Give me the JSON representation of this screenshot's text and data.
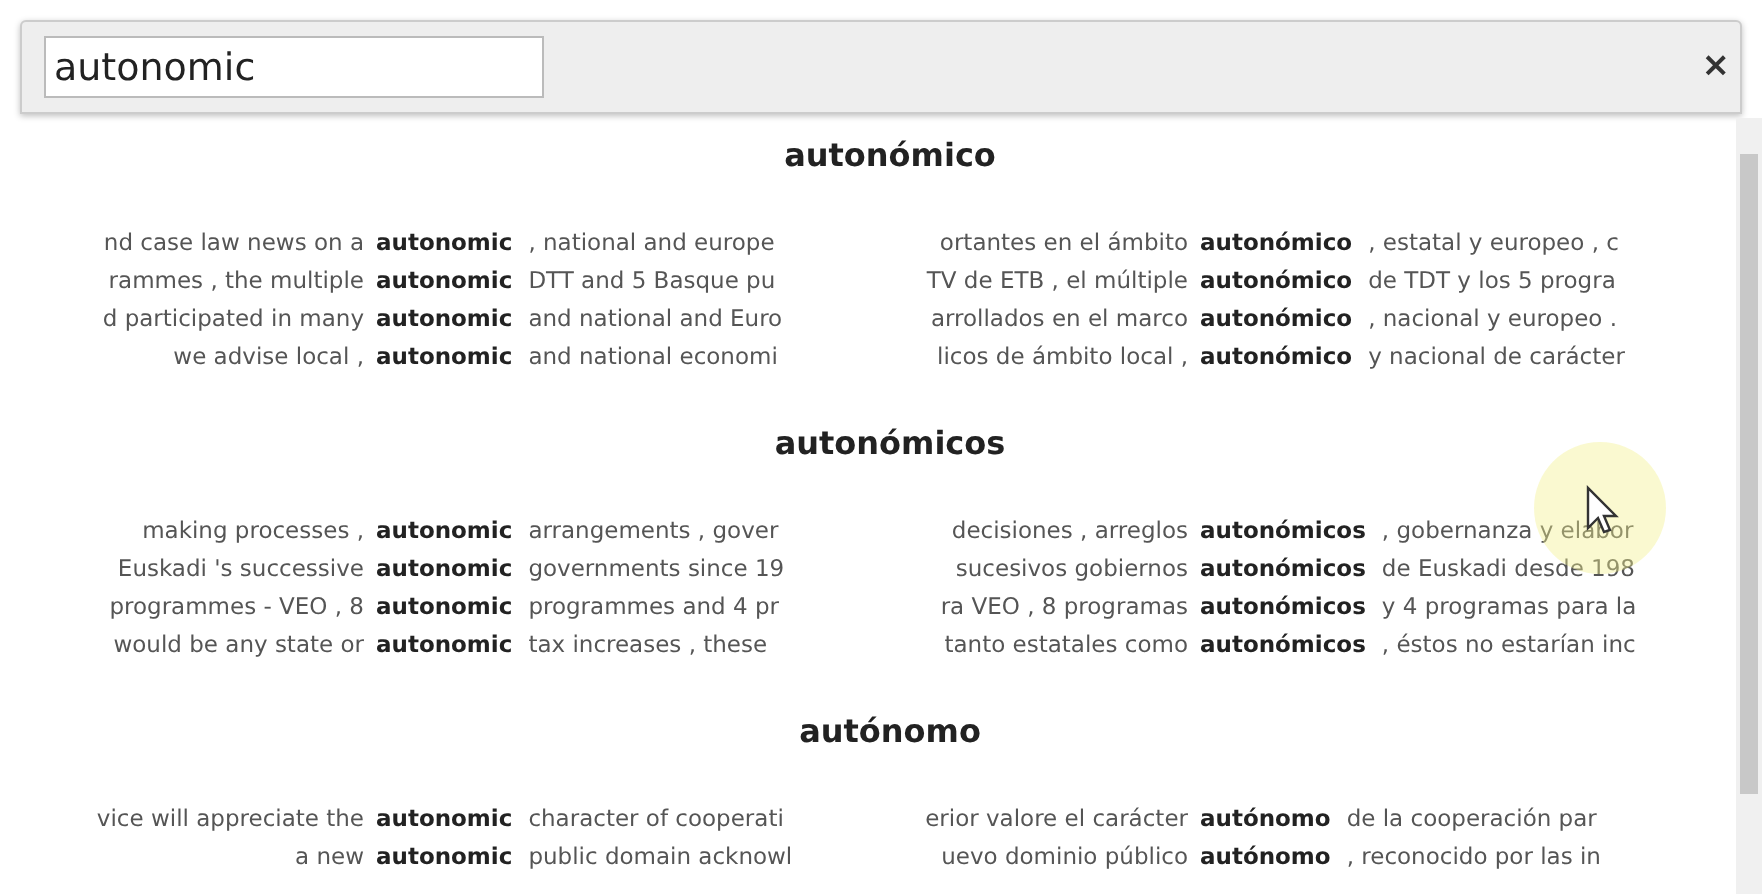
{
  "search": {
    "value": "autonomic"
  },
  "close": "×",
  "sections": [
    {
      "heading": "autonómico",
      "rows": [
        {
          "en": {
            "left": "nd case law news on a",
            "keyword": "autonomic",
            "right": ", national and europe"
          },
          "es": {
            "left": "ortantes en el ámbito",
            "keyword": "autonómico",
            "right": ", estatal y europeo , c"
          }
        },
        {
          "en": {
            "left": "rammes , the multiple",
            "keyword": "autonomic",
            "right": "DTT and 5 Basque pu"
          },
          "es": {
            "left": "TV de ETB , el múltiple",
            "keyword": "autonómico",
            "right": "de TDT y los 5 progra"
          }
        },
        {
          "en": {
            "left": "d participated in many",
            "keyword": "autonomic",
            "right": "and national and Euro"
          },
          "es": {
            "left": "arrollados en el marco",
            "keyword": "autonómico",
            "right": ", nacional y europeo ."
          }
        },
        {
          "en": {
            "left": "we advise local ,",
            "keyword": "autonomic",
            "right": "and national economi"
          },
          "es": {
            "left": "licos de ámbito local ,",
            "keyword": "autonómico",
            "right": "y nacional de carácter"
          }
        }
      ]
    },
    {
      "heading": "autonómicos",
      "rows": [
        {
          "en": {
            "left": "making processes ,",
            "keyword": "autonomic",
            "right": "arrangements , gover"
          },
          "es": {
            "left": "decisiones , arreglos",
            "keyword": "autonómicos",
            "right": ", gobernanza y elabor"
          }
        },
        {
          "en": {
            "left": "Euskadi 's successive",
            "keyword": "autonomic",
            "right": "governments since 19"
          },
          "es": {
            "left": "sucesivos gobiernos",
            "keyword": "autonómicos",
            "right": "de Euskadi desde 198"
          }
        },
        {
          "en": {
            "left": "programmes - VEO , 8",
            "keyword": "autonomic",
            "right": "programmes and 4 pr"
          },
          "es": {
            "left": "ra VEO , 8 programas",
            "keyword": "autonómicos",
            "right": "y 4 programas para la"
          }
        },
        {
          "en": {
            "left": "would be any state or",
            "keyword": "autonomic",
            "right": "tax increases , these"
          },
          "es": {
            "left": "tanto estatales como",
            "keyword": "autonómicos",
            "right": ", éstos no estarían inc"
          }
        }
      ]
    },
    {
      "heading": "autónomo",
      "rows": [
        {
          "en": {
            "left": "vice will appreciate the",
            "keyword": "autonomic",
            "right": "character of cooperati"
          },
          "es": {
            "left": "erior valore el carácter",
            "keyword": "autónomo",
            "right": "de la cooperación par"
          }
        },
        {
          "en": {
            "left": "a new",
            "keyword": "autonomic",
            "right": "public domain acknowl"
          },
          "es": {
            "left": "uevo dominio público",
            "keyword": "autónomo",
            "right": ", reconocido por las in"
          }
        }
      ]
    }
  ]
}
